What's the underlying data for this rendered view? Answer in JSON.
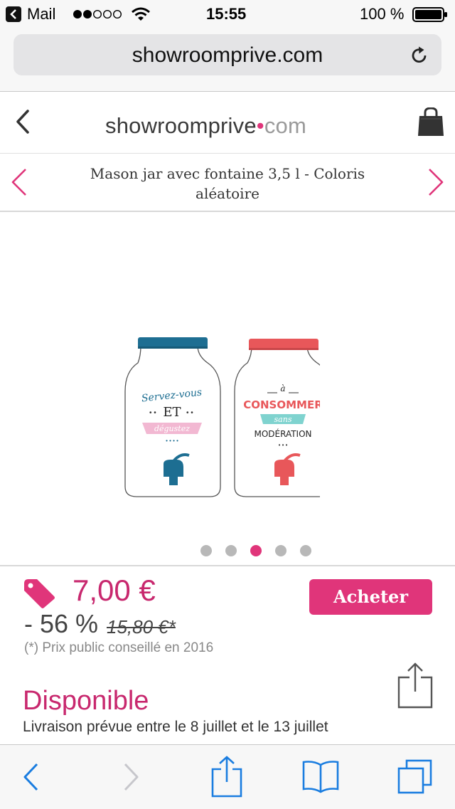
{
  "status_bar": {
    "back_app": "Mail",
    "time": "15:55",
    "battery": "100 %"
  },
  "url_bar": {
    "url": "showroomprive.com"
  },
  "site_header": {
    "logo_main": "showroomprive",
    "logo_dot": "•",
    "logo_tld": "com"
  },
  "product": {
    "title": "Mason jar avec fontaine 3,5 l - Coloris aléatoire",
    "price": "7,00 €",
    "discount": "- 56 %",
    "old_price": "15,80 €*",
    "price_note": "(*) Prix public conseillé en 2016",
    "buy_label": "Acheter",
    "availability": "Disponible",
    "delivery": "Livraison prévue entre le 8 juillet et le 13 juillet"
  },
  "jar_left": {
    "line1": "Servez-vous",
    "line2": "ET",
    "line3": "dégustez",
    "lid_color": "#1d6e92"
  },
  "jar_right": {
    "line1": "à",
    "line2": "CONSOMMER",
    "line3": "sans",
    "line4": "MODÉRATION",
    "lid_color": "#e8575a"
  },
  "carousel": {
    "count": 5,
    "active_index": 2
  },
  "colors": {
    "accent": "#e0357a",
    "price": "#c8286e",
    "ios_blue": "#1a7de0"
  }
}
